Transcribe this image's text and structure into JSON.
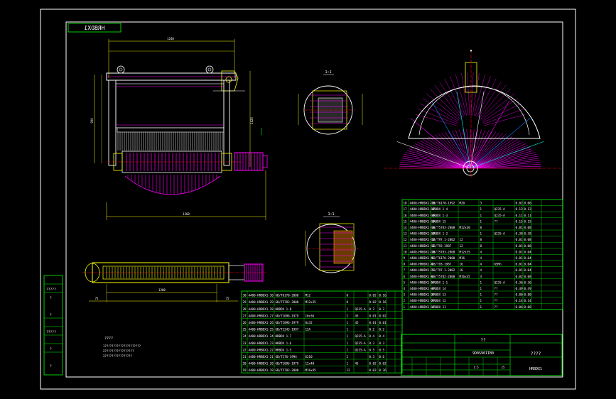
{
  "drawing": {
    "code_top": "HRBDX1",
    "code_bottom": "HRBDX1",
    "center_caption": "????",
    "title_caption": "??",
    "title_code": "9D0S90IIB0",
    "left_notes_title": "????",
    "left_notes_lines": [
      "1?????????????????????",
      "2?????????????????",
      "3????????????????"
    ],
    "left_strip_labels": [
      "?????",
      "?",
      "?",
      "?????",
      "?",
      "?"
    ],
    "section_label_1": "1:1",
    "section_label_2": "1:1",
    "scale_caption": "1",
    "dims": {
      "top_width": "1240",
      "left_height": "990",
      "right_height": "1020",
      "bottom_width": "1260",
      "plan_span": "1200",
      "plan_left": "75",
      "plan_right": "75"
    }
  },
  "bom_right": [
    [
      "18",
      "4400-HRBDX1-18",
      "GB/T6170-1992",
      "M20",
      "3",
      "",
      "0.02",
      "0.06"
    ],
    [
      "17",
      "4400-HRBDX1-17",
      "HRBDX 1-4",
      "",
      "1",
      "Q235-A",
      "0.12",
      "0.12"
    ],
    [
      "16",
      "4400-HRBDX1-16",
      "HRBDX 1-3",
      "",
      "1",
      "Q235-A",
      "0.11",
      "0.11"
    ],
    [
      "15",
      "4400-HRBDX1-15",
      "HRBDX 15",
      "",
      "1",
      "??",
      "0.15",
      "0.15"
    ],
    [
      "14",
      "4400-HRBDX1-14",
      "GB/T5783-2000",
      "M12x30",
      "8",
      "",
      "0.01",
      "0.08"
    ],
    [
      "13",
      "4400-HRBDX1-13",
      "HRBDX 1-2",
      "",
      "1",
      "Q235-A",
      "0.38",
      "0.38"
    ],
    [
      "12",
      "4400-HRBDX1-12",
      "GB/T97.1-2002",
      "12",
      "8",
      "",
      "0.01",
      "0.08"
    ],
    [
      "11",
      "4400-HRBDX1-11",
      "GB/T93-1987",
      "12",
      "8",
      "",
      "0.01",
      "0.08"
    ],
    [
      "10",
      "4400-HRBDX1-10",
      "GB/T5783-2000",
      "M12x35",
      "4",
      "",
      "0.01",
      "0.04"
    ],
    [
      "9",
      "4400-HRBDX1-9",
      "GB/T6170-2000",
      "M16",
      "4",
      "",
      "0.01",
      "0.04"
    ],
    [
      "8",
      "4400-HRBDX1-8",
      "GB/T93-1987",
      "16",
      "4",
      "65Mn",
      "0.01",
      "0.04"
    ],
    [
      "7",
      "4400-HRBDX1-7",
      "GB/T97.1-2002",
      "16",
      "4",
      "",
      "0.01",
      "0.04"
    ],
    [
      "6",
      "4400-HRBDX1-6",
      "GB/T5782-2000",
      "M16x35",
      "4",
      "",
      "0.02",
      "0.08"
    ],
    [
      "5",
      "4400-HRBDX1-5",
      "HRBDX 1-1",
      "",
      "1",
      "Q235-A",
      "0.36",
      "0.36"
    ],
    [
      "4",
      "4400-HRBDX1-4",
      "HRBDX 14",
      "",
      "1",
      "??",
      "0.49",
      "0.49"
    ],
    [
      "3",
      "4400-HRBDX1-3",
      "HRBDX 13",
      "",
      "1",
      "??",
      "0.80",
      "0.80"
    ],
    [
      "2",
      "4400-HRBDX1-2",
      "HRBDX 12",
      "",
      "1",
      "??",
      "0.14",
      "0.14"
    ],
    [
      "1",
      "4400-HRBDX1-1",
      "HRBDX 11",
      "",
      "1",
      "??",
      "0.06",
      "0.06"
    ]
  ],
  "bom_right_header": [
    "??",
    "?",
    "?",
    "?",
    "?",
    "?",
    "?",
    "?"
  ],
  "bom_center": [
    [
      "30",
      "4400-HRBDX1-30",
      "GB/T6170-2000",
      "M12",
      "8",
      "",
      "0.02",
      "0.16"
    ],
    [
      "29",
      "4400-HRBDX1-29",
      "GB/T5783-2000",
      "M12x35",
      "8",
      "",
      "0.02",
      "0.16"
    ],
    [
      "28",
      "4400-HRBDX1-28",
      "HRBDX 1-8",
      "",
      "1",
      "Q235-A",
      "0.2",
      "0.2"
    ],
    [
      "27",
      "4400-HRBDX1-27",
      "GB/T1096-1979",
      "10x36",
      "2",
      "45",
      "0.01",
      "0.02"
    ],
    [
      "26",
      "4400-HRBDX1-26",
      "GB/T1096-1979",
      "8x32",
      "1",
      "45",
      "0.01",
      "0.01"
    ],
    [
      "25",
      "4400-HRBDX1-25",
      "GB/T1243-1997",
      "12A",
      "1",
      "",
      "0.2",
      "0.2"
    ],
    [
      "24",
      "4400-HRBDX1-24",
      "HRBDX 1-7",
      "",
      "1",
      "Q235-A",
      "0.4",
      "0.4"
    ],
    [
      "23",
      "4400-HRBDX1-23",
      "HRBDX 1-6",
      "",
      "1",
      "Q235-A",
      "0.3",
      "0.3"
    ],
    [
      "22",
      "4400-HRBDX1-22",
      "HRBDX 1-5",
      "",
      "1",
      "Q235-A",
      "0.5",
      "0.5"
    ],
    [
      "21",
      "4400-HRBDX1-21",
      "GB/T276-1994",
      "6210",
      "2",
      "",
      "0.3",
      "0.6"
    ],
    [
      "20",
      "4400-HRBDX1-20",
      "GB/T1096-1979",
      "12x40",
      "1",
      "45",
      "0.02",
      "0.02"
    ],
    [
      "19",
      "4400-HRBDX1-19",
      "GB/T5783-2000",
      "M16x45",
      "12",
      "",
      "0.03",
      "0.36"
    ]
  ],
  "title_block": {
    "row1": [
      "?",
      "?",
      "?",
      "?",
      "?",
      "?"
    ],
    "scale": "1:5",
    "sheet": "15"
  }
}
